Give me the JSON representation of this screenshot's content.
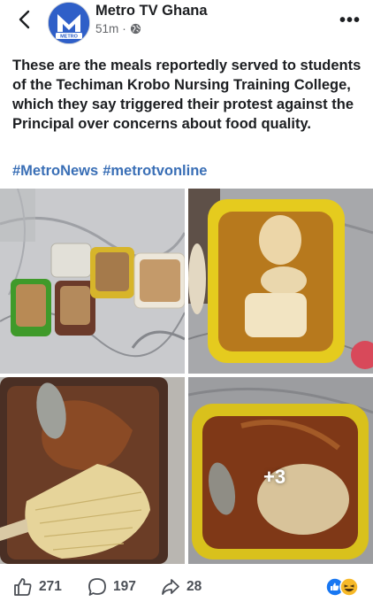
{
  "header": {
    "page_name": "Metro TV Ghana",
    "time": "51m",
    "separator": "·",
    "more_label": "•••",
    "avatar_text": "METRO"
  },
  "post": {
    "text": "These are the meals reportedly served to students of the Techiman Krobo Nursing Training College, which they say triggered their protest against the Principal over concerns about food quality.",
    "hashtags": [
      "#MetroNews",
      "#metrotvonline"
    ]
  },
  "photos": {
    "more_count": "+3"
  },
  "footer": {
    "likes": "271",
    "comments": "197",
    "shares": "28"
  },
  "icons": {
    "back": "chevron-left-icon",
    "privacy": "globe-icon",
    "like": "thumbs-up-icon",
    "comment": "comment-bubble-icon",
    "share": "share-arrow-icon",
    "reactions": "like-haha-reactions-icon"
  },
  "colors": {
    "hashtag": "#3a6fb6",
    "like_blue": "#1877f2",
    "haha_yellow": "#f7b928"
  }
}
